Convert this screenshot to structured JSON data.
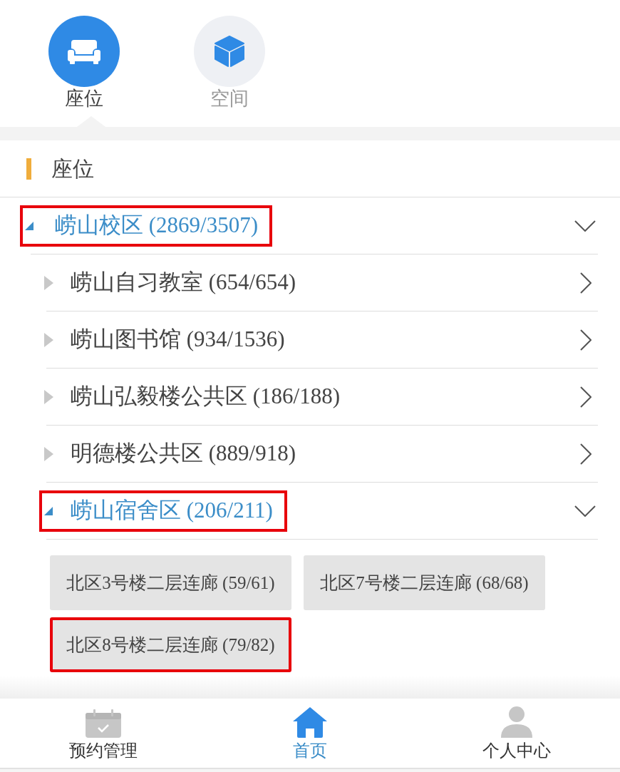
{
  "tabs": [
    {
      "label": "座位",
      "selected": true
    },
    {
      "label": "空间",
      "selected": false
    }
  ],
  "section": {
    "title": "座位"
  },
  "tree": [
    {
      "label": "崂山校区 (2869/3507)",
      "expanded": true,
      "highlighted": true,
      "children": [
        {
          "label": "崂山自习教室 (654/654)",
          "expanded": false,
          "highlighted": false
        },
        {
          "label": "崂山图书馆 (934/1536)",
          "expanded": false,
          "highlighted": false
        },
        {
          "label": "崂山弘毅楼公共区 (186/188)",
          "expanded": false,
          "highlighted": false
        },
        {
          "label": "明德楼公共区 (889/918)",
          "expanded": false,
          "highlighted": false
        },
        {
          "label": "崂山宿舍区 (206/211)",
          "expanded": true,
          "highlighted": true,
          "children": [
            {
              "label": "北区3号楼二层连廊 (59/61)",
              "highlighted": false
            },
            {
              "label": "北区7号楼二层连廊 (68/68)",
              "highlighted": false
            },
            {
              "label": "北区8号楼二层连廊 (79/82)",
              "highlighted": true
            }
          ]
        }
      ]
    }
  ],
  "bottom_nav": [
    {
      "label": "预约管理",
      "selected": false
    },
    {
      "label": "首页",
      "selected": true
    },
    {
      "label": "个人中心",
      "selected": false
    }
  ]
}
